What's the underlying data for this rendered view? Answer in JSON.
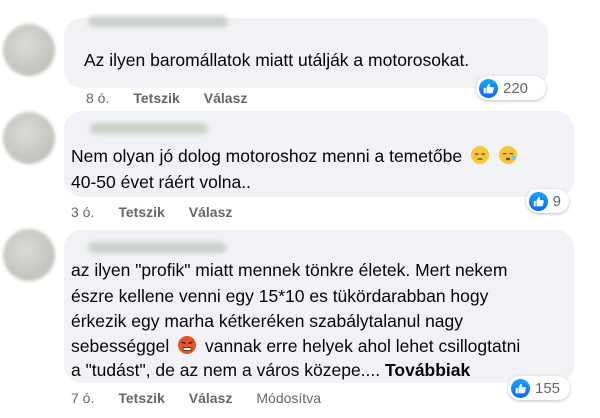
{
  "comments": [
    {
      "lines": [
        "Az ilyen baromállatok miatt utálják a motorosokat."
      ],
      "time": "8 ó.",
      "like_label": "Tetszik",
      "reply_label": "Válasz",
      "reaction_count": "220"
    },
    {
      "lines": [
        "Nem olyan jó dolog motoroshoz menni a temetőbe",
        "40-50 évet ráért volna.."
      ],
      "emojis": [
        "pensive-face-emoji",
        "sleepy-face-emoji"
      ],
      "time": "3 ó.",
      "like_label": "Tetszik",
      "reply_label": "Válasz",
      "reaction_count": "9"
    },
    {
      "lines": [
        "az ilyen \"profik\" miatt mennek tönkre életek. Mert nekem",
        "észre kellene venni egy 15*10 es tükördarabban hogy",
        "érkezik egy marha kétkeréken szabálytalanul nagy",
        "sebességgel",
        "vannak erre helyek ahol lehet csillogtatni",
        "a \"tudást\", de az nem a város közepe...."
      ],
      "emoji": "angry-face-emoji",
      "more_label": "Továbbiak",
      "time": "7 ó.",
      "like_label": "Tetszik",
      "reply_label": "Válasz",
      "edited_label": "Módosítva",
      "reaction_count": "155"
    }
  ],
  "colors": {
    "bubble": "#f0f2f5",
    "meta_text": "#65676b",
    "like_blue": "#0866ff"
  }
}
